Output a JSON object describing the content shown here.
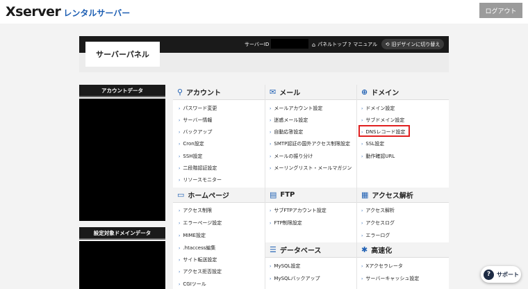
{
  "header": {
    "logo_main": "Xserver",
    "logo_sub": "レンタルサーバー",
    "logout_label": "ログアウト"
  },
  "panel": {
    "title": "サーバーパネル",
    "server_id_label": "サーバーID",
    "panel_top": "パネルトップ",
    "manual": "マニュアル",
    "old_design": "旧デザインに切り替え"
  },
  "sidebar": {
    "account_data": "アカウントデータ",
    "domain_data": "設定対象ドメインデータ"
  },
  "sections": {
    "account": {
      "title": "アカウント",
      "icon": "user-icon",
      "items": [
        "パスワード変更",
        "サーバー情報",
        "バックアップ",
        "Cron設定",
        "SSH設定",
        "二段階認証設定",
        "リソースモニター"
      ]
    },
    "mail": {
      "title": "メール",
      "icon": "mail-icon",
      "items": [
        "メールアカウント設定",
        "迷惑メール設定",
        "自動応答設定",
        "SMTP認証の国外アクセス制限設定",
        "メールの振り分け",
        "メーリングリスト・メールマガジン"
      ]
    },
    "domain": {
      "title": "ドメイン",
      "icon": "globe-icon",
      "items": [
        "ドメイン設定",
        "サブドメイン設定",
        "DNSレコード設定",
        "SSL設定",
        "動作確認URL"
      ]
    },
    "homepage": {
      "title": "ホームページ",
      "icon": "window-icon",
      "items": [
        "アクセス制限",
        "エラーページ設定",
        "MIME設定",
        ".htaccess編集",
        "サイト転送設定",
        "アクセス拒否設定",
        "CGIツール"
      ]
    },
    "ftp": {
      "title": "FTP",
      "icon": "ftp-icon",
      "items": [
        "サブFTPアカウント設定",
        "FTP制限設定"
      ]
    },
    "analytics": {
      "title": "アクセス解析",
      "icon": "chart-icon",
      "items": [
        "アクセス解析",
        "アクセスログ",
        "エラーログ"
      ]
    },
    "database": {
      "title": "データベース",
      "icon": "database-icon",
      "items": [
        "MySQL設定",
        "MySQLバックアップ"
      ]
    },
    "speed": {
      "title": "高速化",
      "icon": "speed-icon",
      "items": [
        "Xアクセラレータ",
        "サーバーキャッシュ設定"
      ]
    }
  },
  "support": {
    "label": "サポート"
  },
  "colors": {
    "accent": "#1e5fb3",
    "highlight": "#e02020",
    "dark": "#1a1a1a"
  }
}
